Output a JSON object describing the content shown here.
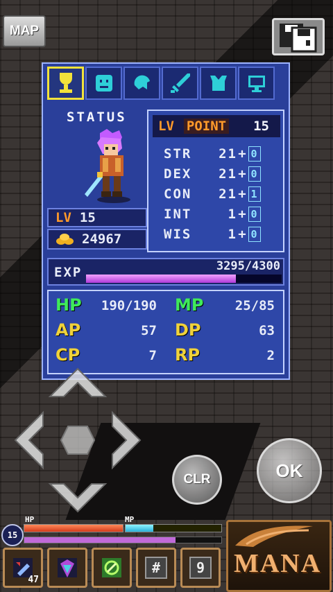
{
  "top": {
    "map_label": "MAP"
  },
  "tabs": [
    {
      "icon": "trophy-icon"
    },
    {
      "icon": "face-icon"
    },
    {
      "icon": "helmet-icon"
    },
    {
      "icon": "sword-icon"
    },
    {
      "icon": "armor-icon"
    },
    {
      "icon": "monitor-icon"
    }
  ],
  "status": {
    "title": "STATUS",
    "lv_label": "LV",
    "lv_value": "15",
    "gold": "24967",
    "lv_point_label_lv": "LV",
    "lv_point_label_point": "POINT",
    "lv_point_value": "15",
    "stats": [
      {
        "name": "STR",
        "value": "21",
        "plus": "+",
        "bonus": "0"
      },
      {
        "name": "DEX",
        "value": "21",
        "plus": "+",
        "bonus": "0"
      },
      {
        "name": "CON",
        "value": "21",
        "plus": "+",
        "bonus": "1"
      },
      {
        "name": "INT",
        "value": "1",
        "plus": "+",
        "bonus": "0"
      },
      {
        "name": "WIS",
        "value": "1",
        "plus": "+",
        "bonus": "0"
      }
    ],
    "exp_label": "EXP",
    "exp_value": "3295/4300",
    "exp_fraction": 0.766,
    "hp_label": "HP",
    "hp_value": "190/190",
    "mp_label": "MP",
    "mp_value": "25/85",
    "ap_label": "AP",
    "ap_value": "57",
    "dp_label": "DP",
    "dp_value": "63",
    "cp_label": "CP",
    "cp_value": "7",
    "rp_label": "RP",
    "rp_value": "2"
  },
  "controls": {
    "clr_label": "CLR",
    "ok_label": "OK"
  },
  "hud": {
    "level": "15",
    "hp_label": "HP",
    "mp_label": "MP",
    "hp_fraction": 1.0,
    "mp_fraction": 0.29,
    "slots": [
      {
        "icon": "potion-icon",
        "count": "47"
      },
      {
        "icon": "crystal-icon",
        "count": ""
      },
      {
        "icon": "rune-icon",
        "count": ""
      },
      {
        "icon": "hash-key-icon",
        "key": "#"
      },
      {
        "icon": "nine-key-icon",
        "key": "9"
      }
    ],
    "mana_label": "MANA"
  },
  "colors": {
    "panel": "#2a3f9a",
    "accent_orange": "#ff9a2a",
    "hp_green": "#3fea5a",
    "ap_yellow": "#f0d23a"
  }
}
